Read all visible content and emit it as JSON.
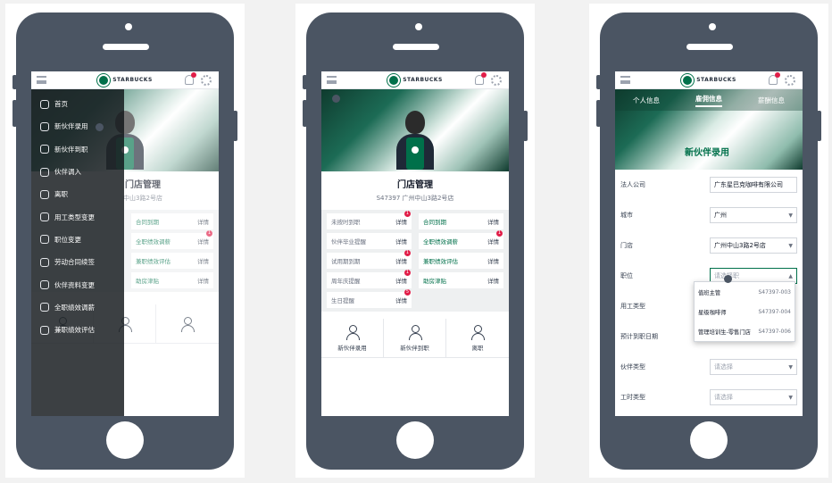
{
  "brand": "STARBUCKS",
  "colors": {
    "phone": "#4b5563",
    "accent": "#00704a",
    "badge": "#e11d48"
  },
  "phone1": {
    "drawer_items": [
      "首页",
      "新伙伴录用",
      "新伙伴到职",
      "伙伴调入",
      "离职",
      "用工类型变更",
      "职位变更",
      "劳动合同续签",
      "伙伴资料变更",
      "全职绩效调薪",
      "兼职绩效评估"
    ],
    "store_title": "门店管理",
    "store_addr": "中山3路2号店",
    "tiles": [
      {
        "label": "合同到期",
        "detail": "详情",
        "badge": ""
      },
      {
        "label": "全职绩效调薪",
        "detail": "详情",
        "badge": "1"
      },
      {
        "label": "兼职绩效评估",
        "detail": "详情",
        "badge": ""
      },
      {
        "label": "助房津贴",
        "detail": "详情",
        "badge": ""
      }
    ]
  },
  "phone2": {
    "store_title": "门店管理",
    "store_addr": "S47397 广州中山3路2号店",
    "left_tiles": [
      {
        "label": "未按时到职",
        "detail": "详情",
        "badge": "1"
      },
      {
        "label": "伙伴毕业提醒",
        "detail": "详情",
        "badge": ""
      },
      {
        "label": "试用期到期",
        "detail": "详情",
        "badge": "1"
      },
      {
        "label": "周年庆提醒",
        "detail": "详情",
        "badge": "1"
      },
      {
        "label": "生日提醒",
        "detail": "详情",
        "badge": "5"
      }
    ],
    "right_tiles": [
      {
        "label": "合同到期",
        "detail": "详情",
        "badge": ""
      },
      {
        "label": "全职绩效调薪",
        "detail": "详情",
        "badge": "1"
      },
      {
        "label": "兼职绩效评估",
        "detail": "详情",
        "badge": ""
      },
      {
        "label": "助房津贴",
        "detail": "详情",
        "badge": ""
      }
    ],
    "icons": [
      "新伙伴录用",
      "新伙伴到职",
      "离职"
    ]
  },
  "phone3": {
    "tabs": [
      "个人信息",
      "雇佣信息",
      "薪酬信息"
    ],
    "title": "新伙伴录用",
    "fields": [
      {
        "label": "法人公司",
        "value": "广东星巴克咖啡有限公司",
        "placeholder": false
      },
      {
        "label": "城市",
        "value": "广州",
        "placeholder": false
      },
      {
        "label": "门店",
        "value": "广州中山3路2号店",
        "placeholder": false
      },
      {
        "label": "职位",
        "value": "请选择职",
        "placeholder": true
      },
      {
        "label": "用工类型",
        "value": "",
        "placeholder": true
      },
      {
        "label": "预计到职日期",
        "value": "",
        "placeholder": true
      },
      {
        "label": "伙伴类型",
        "value": "请选择",
        "placeholder": true
      },
      {
        "label": "工时类型",
        "value": "请选择",
        "placeholder": true
      }
    ],
    "dropdown": [
      {
        "name": "值班主管",
        "code": "S47397-003"
      },
      {
        "name": "星级咖啡师",
        "code": "S47397-004"
      },
      {
        "name": "管理培训生-零售门店",
        "code": "S47397-006"
      }
    ]
  }
}
